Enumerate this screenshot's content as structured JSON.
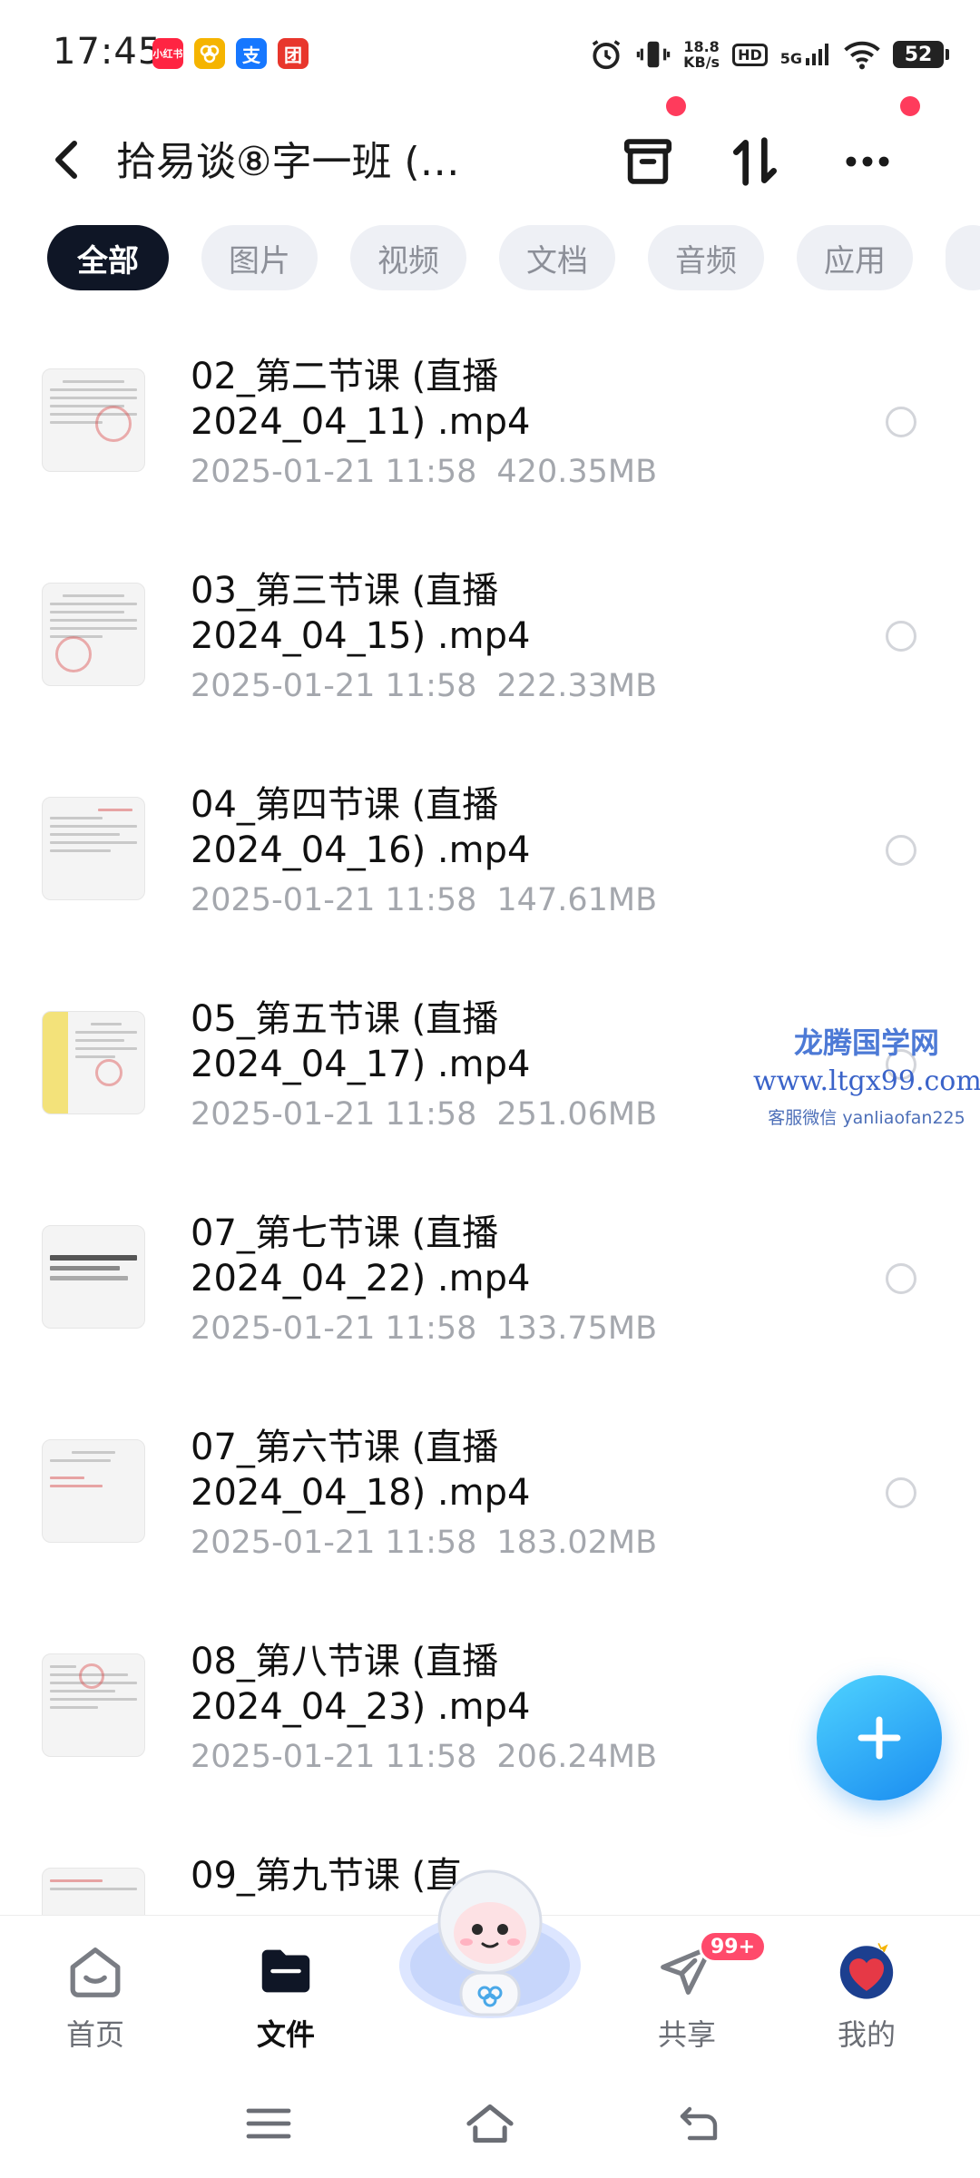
{
  "status_bar": {
    "time": "17:45",
    "app_icons": [
      {
        "name": "xiaohongshu-icon",
        "label": "小红书",
        "color": "#ff2442"
      },
      {
        "name": "cluster-app-icon",
        "label": "",
        "color": "#f5b400"
      },
      {
        "name": "alipay-icon",
        "label": "支",
        "color": "#1677ff"
      },
      {
        "name": "meituan-icon",
        "label": "团",
        "color": "#e8362c"
      }
    ],
    "speed_value": "18.8",
    "speed_unit": "KB/s",
    "hd_label": "HD",
    "network_label": "5G",
    "battery": "52"
  },
  "header": {
    "title": "拾易谈⑧字一班 (…",
    "back_icon": "chevron-left-icon",
    "archive_icon": "archive-box-icon",
    "sort_icon": "sort-arrows-icon",
    "more_icon": "more-dots-icon",
    "dot_color": "#ff3b5c"
  },
  "filters": {
    "chips": [
      "全部",
      "图片",
      "视频",
      "文档",
      "音频",
      "应用"
    ],
    "active_index": 0
  },
  "files": [
    {
      "title_line1": "02_第二节课 (直播",
      "title_line2": "2024_04_11) .mp4",
      "date": "2025-01-21  11:58",
      "size": "420.35MB"
    },
    {
      "title_line1": "03_第三节课 (直播",
      "title_line2": "2024_04_15) .mp4",
      "date": "2025-01-21  11:58",
      "size": "222.33MB"
    },
    {
      "title_line1": "04_第四节课 (直播",
      "title_line2": "2024_04_16) .mp4",
      "date": "2025-01-21  11:58",
      "size": "147.61MB"
    },
    {
      "title_line1": "05_第五节课 (直播",
      "title_line2": "2024_04_17) .mp4",
      "date": "2025-01-21  11:58",
      "size": "251.06MB"
    },
    {
      "title_line1": "07_第七节课 (直播",
      "title_line2": "2024_04_22) .mp4",
      "date": "2025-01-21  11:58",
      "size": "133.75MB"
    },
    {
      "title_line1": "07_第六节课 (直播",
      "title_line2": "2024_04_18) .mp4",
      "date": "2025-01-21  11:58",
      "size": "183.02MB"
    },
    {
      "title_line1": "08_第八节课 (直播",
      "title_line2": "2024_04_23) .mp4",
      "date": "2025-01-21  11:58",
      "size": "206.24MB"
    },
    {
      "title_line1": "09_第九节课 (直",
      "title_line2": "",
      "date": "",
      "size": ""
    }
  ],
  "watermark": {
    "line1": "龙腾国学网",
    "line2": "www.ltgx99.com",
    "line3": "客服微信 yanliaofan225"
  },
  "fab": {
    "icon": "plus-icon",
    "color": "#1a8cf0"
  },
  "bottom_nav": {
    "items": [
      {
        "label": "首页",
        "icon": "home-icon"
      },
      {
        "label": "文件",
        "icon": "folder-icon"
      },
      {
        "label": "",
        "icon": "mascot-astronaut-icon"
      },
      {
        "label": "共享",
        "icon": "send-plane-icon"
      },
      {
        "label": "我的",
        "icon": "heart-avatar-icon"
      }
    ],
    "active_index": 1,
    "share_badge": "99+"
  },
  "system_nav": {
    "menu_icon": "menu-lines-icon",
    "home_icon": "home-outline-icon",
    "back_icon": "back-arrow-icon"
  }
}
